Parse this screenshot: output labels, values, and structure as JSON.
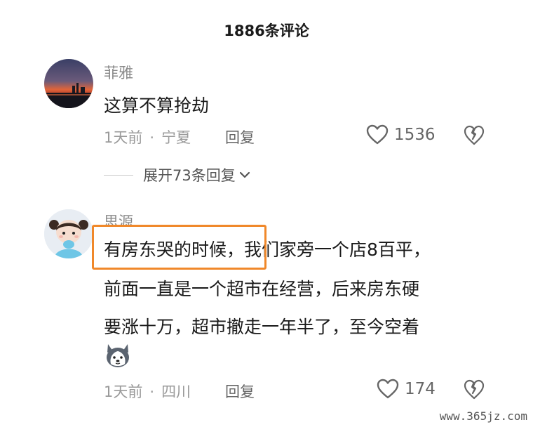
{
  "header": {
    "title": "1886条评论"
  },
  "comments": [
    {
      "username": "菲雅",
      "lines": [
        "这算不算抢劫"
      ],
      "time": "1天前",
      "location": "宁夏",
      "reply_label": "回复",
      "likes": "1536",
      "expand_label": "展开73条回复"
    },
    {
      "username": "思源",
      "lines": [
        "有房东哭的时候，我们家旁一个店8百平，",
        "前面一直是一个超市在经营，后来房东硬",
        "要涨十万，超市撤走一年半了，至今空着"
      ],
      "time": "1天前",
      "location": "四川",
      "reply_label": "回复",
      "likes": "174"
    }
  ],
  "separator": "·",
  "watermark": "www.365jz.com",
  "colors": {
    "highlight": "#f0882a",
    "meta": "#9a9a9a"
  },
  "icons": {
    "like": "heart-outline-icon",
    "dislike": "broken-heart-icon",
    "expand": "chevron-down-icon"
  }
}
